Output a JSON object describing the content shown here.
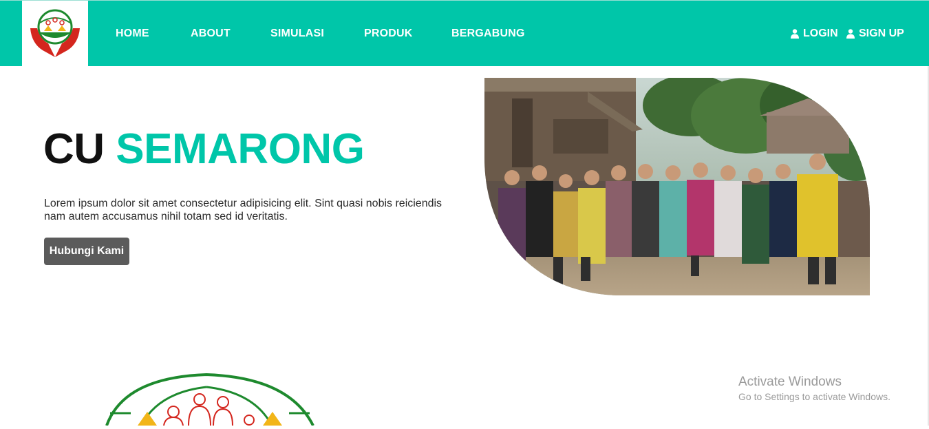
{
  "nav": {
    "logo_alt": "CU Semarong logo",
    "links": [
      "HOME",
      "ABOUT",
      "SIMULASI",
      "PRODUK",
      "BERGABUNG"
    ],
    "login": "LOGIN",
    "signup": "SIGN UP",
    "icons": {
      "login": "user-icon",
      "signup": "user-icon"
    }
  },
  "hero": {
    "title_part1": "CU",
    "title_part2": "SEMARONG",
    "description": "Lorem ipsum dolor sit amet consectetur adipisicing elit. Sint quasi nobis reiciendis nam autem accusamus nihil totam sed id veritatis.",
    "cta_label": "Hubungi Kami",
    "image_description": "group photo of villagers in front of wooden houses"
  },
  "watermark": {
    "line1": "Activate Windows",
    "line2": "Go to Settings to activate Windows."
  },
  "colors": {
    "brand": "#00c6a9",
    "button": "#5b5b5b",
    "logo_green": "#1e8a2e",
    "logo_red": "#d4261e",
    "logo_yellow": "#f2b518"
  }
}
